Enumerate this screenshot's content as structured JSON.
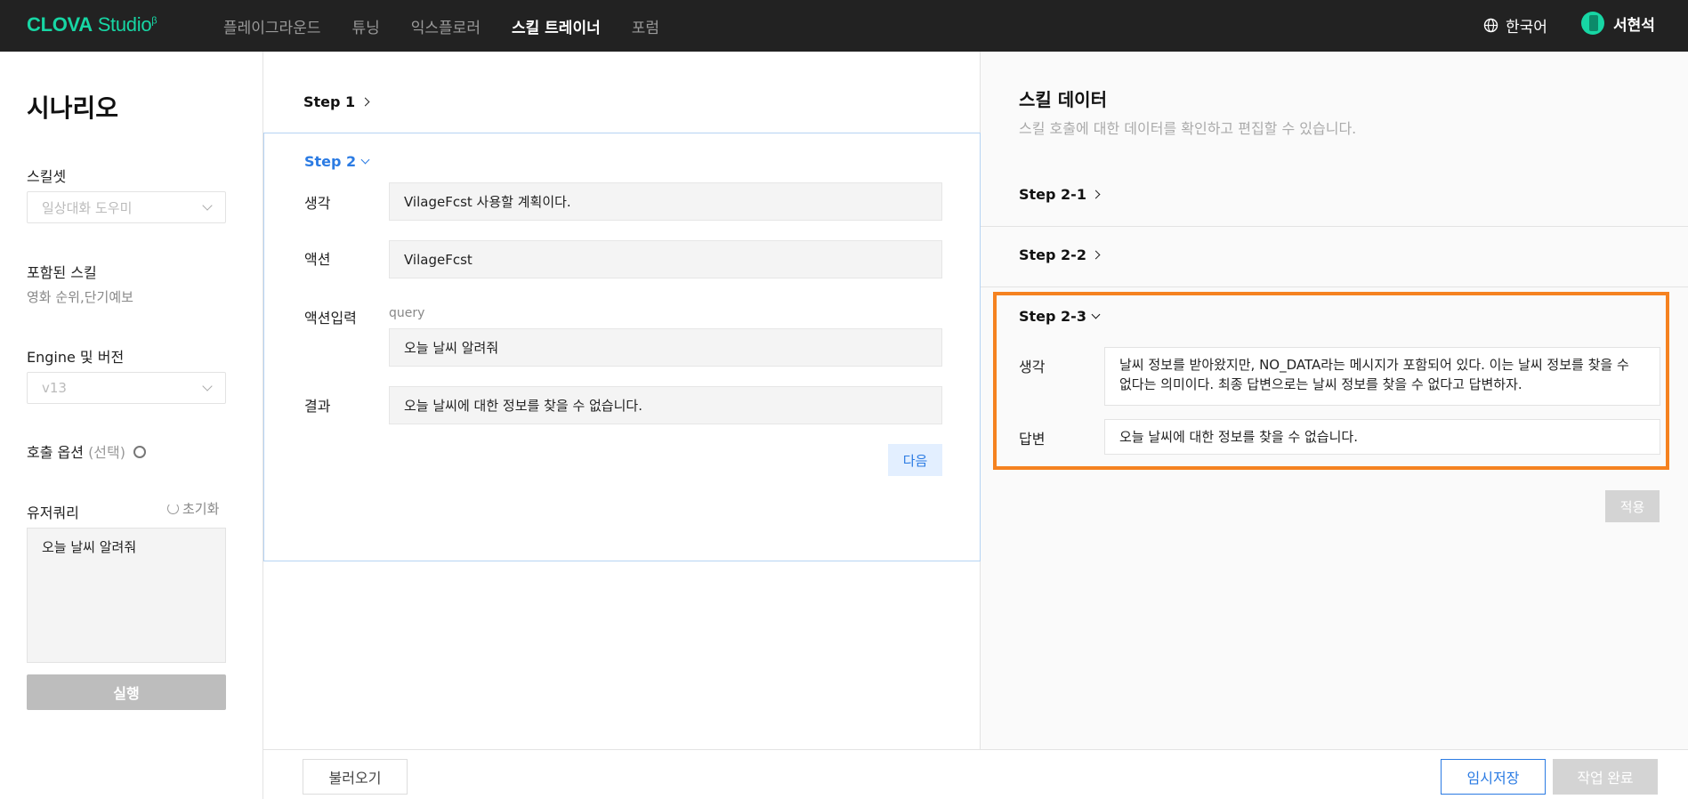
{
  "header": {
    "logo_brand": "CLOVA",
    "logo_product": "Studio",
    "logo_sup": "β",
    "nav": [
      "플레이그라운드",
      "튜닝",
      "익스플로러",
      "스킬 트레이너",
      "포럼"
    ],
    "active_nav": "스킬 트레이너",
    "language": "한국어",
    "user_name": "서현석"
  },
  "sidebar": {
    "title": "시나리오",
    "skillset_label": "스킬셋",
    "skillset_value": "일상대화 도우미",
    "included_skills_label": "포함된 스킬",
    "included_skills_value": "영화 순위,단기예보",
    "engine_label": "Engine 및 버전",
    "engine_value": "v13",
    "call_options_label": "호출 옵션",
    "call_options_note": "(선택)",
    "user_query_label": "유저쿼리",
    "reset_label": "초기화",
    "user_query_value": "오늘 날씨 알려줘",
    "run_label": "실행"
  },
  "middle": {
    "step1_label": "Step 1",
    "step2_label": "Step 2",
    "thought_label": "생각",
    "thought_value": "VilageFcst 사용할 계획이다.",
    "action_label": "액션",
    "action_value": "VilageFcst",
    "action_input_label": "액션입력",
    "action_input_key": "query",
    "action_input_value": "오늘 날씨 알려줘",
    "result_label": "결과",
    "result_value": "오늘 날씨에 대한 정보를 찾을 수 없습니다.",
    "next_label": "다음"
  },
  "skill_data": {
    "title": "스킬 데이터",
    "description": "스킬 호출에 대한 데이터를 확인하고 편집할 수 있습니다.",
    "step21_label": "Step 2-1",
    "step22_label": "Step 2-2",
    "step23_label": "Step 2-3",
    "thought_label": "생각",
    "thought_value": "날씨 정보를 받아왔지만, NO_DATA라는 메시지가 포함되어 있다. 이는 날씨 정보를 찾을 수 없다는 의미이다. 최종 답변으로는 날씨 정보를 찾을 수 없다고 답변하자.",
    "answer_label": "답변",
    "answer_value": "오늘 날씨에 대한 정보를 찾을 수 없습니다.",
    "apply_label": "적용",
    "highlight_color": "#f58220"
  },
  "footer": {
    "load_label": "불러오기",
    "save_label": "임시저장",
    "done_label": "작업 완료"
  },
  "colors": {
    "accent": "#2b7be3",
    "brand": "#17d6a4",
    "topbar": "#222222"
  }
}
